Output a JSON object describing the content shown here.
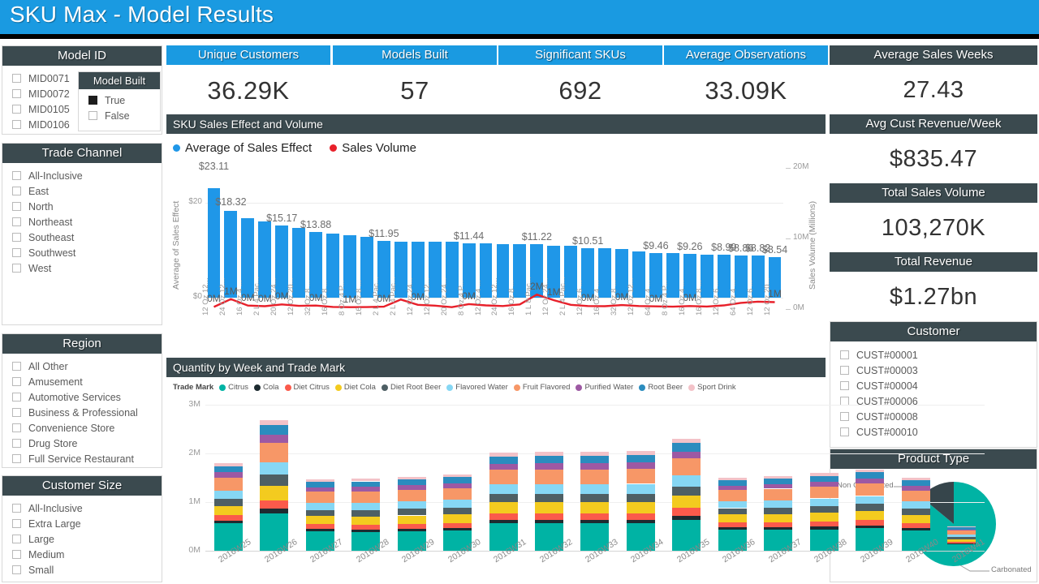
{
  "title": "SKU Max - Model Results",
  "theme": {
    "accent_blue": "#1a9ae1",
    "dark_header": "#3b4a4f",
    "bar_blue": "#1f97e8",
    "line_red": "#e8202a",
    "teal": "#00b3a4"
  },
  "slicers": {
    "model_id": {
      "header": "Model ID",
      "items": [
        {
          "label": "MID0071",
          "checked": false
        },
        {
          "label": "MID0072",
          "checked": false
        },
        {
          "label": "MID0105",
          "checked": false
        },
        {
          "label": "MID0106",
          "checked": false
        }
      ]
    },
    "model_built": {
      "header": "Model Built",
      "items": [
        {
          "label": "True",
          "checked": true
        },
        {
          "label": "False",
          "checked": false
        }
      ]
    },
    "trade_channel": {
      "header": "Trade Channel",
      "items": [
        {
          "label": "All-Inclusive",
          "checked": false
        },
        {
          "label": "East",
          "checked": false
        },
        {
          "label": "North",
          "checked": false
        },
        {
          "label": "Northeast",
          "checked": false
        },
        {
          "label": "Southeast",
          "checked": false
        },
        {
          "label": "Southwest",
          "checked": false
        },
        {
          "label": "West",
          "checked": false
        }
      ]
    },
    "region": {
      "header": "Region",
      "items": [
        {
          "label": "All Other",
          "checked": false
        },
        {
          "label": "Amusement",
          "checked": false
        },
        {
          "label": "Automotive Services",
          "checked": false
        },
        {
          "label": "Business & Professional",
          "checked": false
        },
        {
          "label": "Convenience Store",
          "checked": false
        },
        {
          "label": "Drug Store",
          "checked": false
        },
        {
          "label": "Full Service Restaurant",
          "checked": false
        }
      ]
    },
    "customer_size": {
      "header": "Customer Size",
      "items": [
        {
          "label": "All-Inclusive",
          "checked": false
        },
        {
          "label": "Extra Large",
          "checked": false
        },
        {
          "label": "Large",
          "checked": false
        },
        {
          "label": "Medium",
          "checked": false
        },
        {
          "label": "Small",
          "checked": false
        }
      ]
    },
    "customer": {
      "header": "Customer",
      "items": [
        {
          "label": "CUST#00001",
          "checked": false
        },
        {
          "label": "CUST#00003",
          "checked": false
        },
        {
          "label": "CUST#00004",
          "checked": false
        },
        {
          "label": "CUST#00006",
          "checked": false
        },
        {
          "label": "CUST#00008",
          "checked": false
        },
        {
          "label": "CUST#00010",
          "checked": false
        }
      ]
    }
  },
  "kpis_top": [
    {
      "header": "Unique Customers",
      "value": "36.29K"
    },
    {
      "header": "Models Built",
      "value": "57"
    },
    {
      "header": "Significant SKUs",
      "value": "692"
    },
    {
      "header": "Average Observations",
      "value": "33.09K"
    }
  ],
  "kpis_right": [
    {
      "header": "Average Sales Weeks",
      "value": "27.43"
    },
    {
      "header": "Avg Cust Revenue/Week",
      "value": "$835.47"
    },
    {
      "header": "Total Sales Volume",
      "value": "103,270K"
    },
    {
      "header": "Total Revenue",
      "value": "$1.27bn"
    }
  ],
  "product_type": {
    "header": "Product Type",
    "slices": [
      {
        "label": "Carbonated",
        "value": 86,
        "color": "#00b3a4"
      },
      {
        "label": "Non Carbonated",
        "value": 14,
        "color": "#36454b"
      }
    ]
  },
  "chart_data": [
    {
      "id": "sku_sales_effect_volume",
      "type": "bar",
      "title": "SKU Sales Effect and Volume",
      "legend": [
        {
          "label": "Average of Sales Effect",
          "color": "#1f97e8"
        },
        {
          "label": "Sales Volume",
          "color": "#e8202a"
        }
      ],
      "ylabel": "Average of Sales Effect",
      "y2label": "Sales Volume (Millions)",
      "ylim": [
        0,
        25
      ],
      "yticks": [
        "$0",
        "$20"
      ],
      "y2lim": [
        0,
        20000000
      ],
      "y2ticks": [
        "0M",
        "10M",
        "20M"
      ],
      "legend_position": "top-left",
      "grid": true,
      "categories": [
        "12 Oz 12...",
        "24 Oz 12...",
        "16 Oz 4 ...",
        "2 L 4 Pac...",
        "20 Oz 24...",
        "12 Oz 20...",
        "32 Oz 8 ...",
        "16 Oz 8 ...",
        "8 Oz 4 P...",
        "16 Oz 8 ...",
        "2 L 4 Pac...",
        "2 L 4 Pac...",
        "12 Oz 24...",
        "12 Oz 12...",
        "20 Oz 24...",
        "8 Oz 4 P...",
        "12 Oz 4 ...",
        "24 Oz 12...",
        "16 Oz 8 ...",
        "1 L 8 Pac...",
        "12 Oz 24...",
        "2 L 4 Pac...",
        "12 Oz 6 ...",
        "16 Oz 4 ...",
        "32 Oz 8 ...",
        "12 Oz 12...",
        "64 Oz 4 ...",
        "8 Oz 4 P...",
        "16 Oz 4 ...",
        "16 Oz 8 ...",
        "12 Oz 6 ...",
        "64 Oz 4 ...",
        "12 Oz 6 ...",
        "12 Oz 20..."
      ],
      "series": [
        {
          "name": "Average of Sales Effect",
          "color": "#1f97e8",
          "values": [
            23.11,
            18.32,
            16.8,
            16.1,
            15.17,
            14.7,
            13.88,
            13.6,
            13.2,
            12.8,
            11.95,
            11.9,
            11.85,
            11.8,
            11.75,
            11.44,
            11.4,
            11.35,
            11.3,
            11.22,
            11.0,
            10.9,
            10.51,
            10.45,
            10.2,
            9.8,
            9.46,
            9.4,
            9.26,
            9.1,
            8.99,
            8.86,
            8.82,
            8.54
          ],
          "labels": [
            "$23.11",
            "$18.32",
            "",
            "",
            "$15.17",
            "",
            "$13.88",
            "",
            "",
            "",
            "$11.95",
            "",
            "",
            "",
            "",
            "$11.44",
            "",
            "",
            "",
            "$11.22",
            "",
            "",
            "$10.51",
            "",
            "",
            "",
            "$9.46",
            "",
            "$9.26",
            "",
            "$8.99",
            "$8.86",
            "$8.82",
            "$8.54"
          ]
        },
        {
          "name": "Sales Volume",
          "color": "#e8202a",
          "values": [
            300000,
            1400000,
            500000,
            400000,
            650000,
            450000,
            500000,
            300000,
            260000,
            280000,
            330000,
            1350000,
            600000,
            480000,
            260000,
            700000,
            520000,
            420000,
            650000,
            2050000,
            1250000,
            600000,
            430000,
            400000,
            560000,
            430000,
            380000,
            330000,
            430000,
            360000,
            520000,
            870000,
            1050000,
            980000
          ],
          "labels": [
            "0M",
            "1M",
            "0M",
            "0M",
            "0M",
            "",
            "0M",
            "",
            "1M",
            "",
            "0M",
            "",
            "0M",
            "",
            "",
            "0M",
            "",
            "",
            "",
            "2M",
            "1M",
            "",
            "0M",
            "",
            "0M",
            "",
            "0M",
            "",
            "0M",
            "",
            "",
            "",
            "",
            "1M"
          ]
        }
      ]
    },
    {
      "id": "quantity_by_week_trade_mark",
      "type": "bar",
      "subtype": "stacked",
      "title": "Quantity by Week and Trade Mark",
      "legend_title": "Trade Mark",
      "legend_position": "top",
      "ylabel": "",
      "ylim": [
        0,
        3000000
      ],
      "yticks": [
        "0M",
        "1M",
        "2M",
        "3M"
      ],
      "grid": true,
      "categories": [
        "2016W25",
        "2016W26",
        "2016W27",
        "2016W28",
        "2016W29",
        "2016W30",
        "2016W31",
        "2016W32",
        "2016W33",
        "2016W34",
        "2016W35",
        "2016W36",
        "2016W37",
        "2016W38",
        "2016W39",
        "2016W40",
        "2016W41"
      ],
      "series": [
        {
          "name": "Citrus",
          "color": "#00b3a4",
          "values": [
            560,
            770,
            400,
            390,
            400,
            410,
            570,
            560,
            560,
            560,
            640,
            430,
            430,
            440,
            460,
            410,
            130
          ]
        },
        {
          "name": "Cola",
          "color": "#1d2b30",
          "values": [
            60,
            90,
            50,
            50,
            50,
            55,
            70,
            70,
            70,
            70,
            80,
            55,
            55,
            55,
            60,
            55,
            20
          ]
        },
        {
          "name": "Diet Citrus",
          "color": "#fb5a4b",
          "values": [
            110,
            180,
            100,
            100,
            105,
            110,
            130,
            140,
            140,
            140,
            160,
            100,
            105,
            110,
            115,
            105,
            35
          ]
        },
        {
          "name": "Diet Cola",
          "color": "#f3cb1f",
          "values": [
            190,
            290,
            160,
            165,
            170,
            175,
            230,
            230,
            230,
            230,
            250,
            160,
            165,
            175,
            180,
            160,
            55
          ]
        },
        {
          "name": "Diet Root Beer",
          "color": "#4e5f64",
          "values": [
            150,
            230,
            130,
            130,
            135,
            140,
            170,
            175,
            175,
            175,
            195,
            130,
            135,
            140,
            145,
            130,
            45
          ]
        },
        {
          "name": "Flavored Water",
          "color": "#86d7f4",
          "values": [
            170,
            260,
            140,
            145,
            150,
            155,
            195,
            200,
            200,
            200,
            225,
            145,
            150,
            155,
            165,
            150,
            50
          ]
        },
        {
          "name": "Fruit Flavored",
          "color": "#f79767",
          "values": [
            260,
            400,
            230,
            235,
            240,
            245,
            300,
            300,
            300,
            305,
            345,
            225,
            235,
            245,
            255,
            230,
            75
          ]
        },
        {
          "name": "Purified Water",
          "color": "#9d59a3",
          "values": [
            110,
            165,
            90,
            95,
            100,
            100,
            125,
            125,
            125,
            130,
            145,
            90,
            95,
            100,
            105,
            95,
            30
          ]
        },
        {
          "name": "Root Beer",
          "color": "#2b8cbe",
          "values": [
            130,
            200,
            110,
            115,
            120,
            125,
            150,
            155,
            155,
            155,
            175,
            110,
            115,
            120,
            130,
            115,
            40
          ]
        },
        {
          "name": "Sport Drink",
          "color": "#f3c2c8",
          "values": [
            60,
            95,
            50,
            55,
            55,
            60,
            75,
            75,
            75,
            80,
            90,
            55,
            55,
            60,
            60,
            55,
            20
          ]
        }
      ]
    }
  ]
}
